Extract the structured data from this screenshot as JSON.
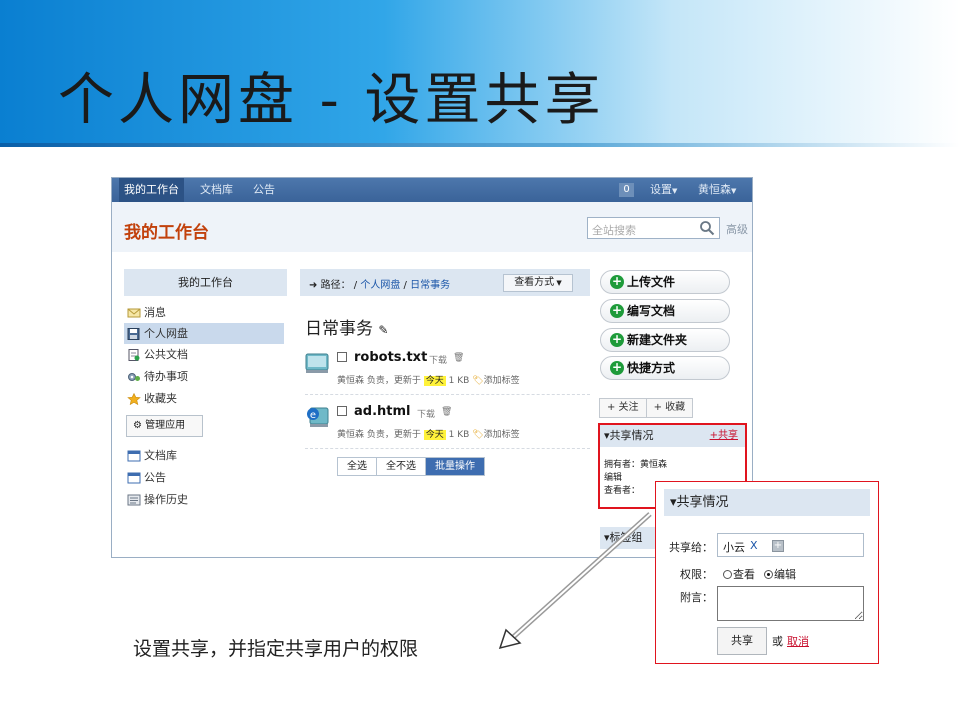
{
  "slide": {
    "title": "个人网盘  -  设置共享",
    "caption": "设置共享，并指定共享用户的权限"
  },
  "colors": {
    "nav_bg": "#3a6399",
    "panel_bg": "#dce6f1",
    "title_orange": "#c2410c",
    "highlight_red": "#e0141e",
    "primary_btn": "#3e6db0",
    "plus_green": "#1e9b3a",
    "today_yellow": "#fff23a"
  },
  "topnav": {
    "items": [
      "我的工作台",
      "文档库",
      "公告"
    ],
    "badge": "0",
    "settings": "设置",
    "user": "黄恒森"
  },
  "header": {
    "title": "我的工作台",
    "search_placeholder": "全站搜索",
    "advanced": "高级"
  },
  "sidebar": {
    "heading": "我的工作台",
    "items": [
      {
        "label": "消息",
        "icon": "envelope-icon"
      },
      {
        "label": "个人网盘",
        "icon": "disk-icon"
      },
      {
        "label": "公共文档",
        "icon": "document-icon"
      },
      {
        "label": "待办事项",
        "icon": "gear-people-icon"
      },
      {
        "label": "收藏夹",
        "icon": "star-icon"
      }
    ],
    "manage_button": "管理应用",
    "items2": [
      {
        "label": "文档库",
        "icon": "window-icon"
      },
      {
        "label": "公告",
        "icon": "window-icon"
      },
      {
        "label": "操作历史",
        "icon": "history-icon"
      }
    ]
  },
  "main": {
    "path_label": "路径：",
    "path_sep": "/",
    "path_items": [
      "个人网盘",
      "日常事务"
    ],
    "view_button": "查看方式",
    "folder_title": "日常事务",
    "files": [
      {
        "name": "robots.txt",
        "download": "下载",
        "owner": "黄恒森 负责，更新于",
        "today": "今天",
        "size": "1 KB",
        "tag": "添加标签"
      },
      {
        "name": "ad.html",
        "download": "下载",
        "owner": "黄恒森 负责，更新于",
        "today": "今天",
        "size": "1 KB",
        "tag": "添加标签"
      }
    ],
    "select_all": "全选",
    "select_none": "全不选",
    "batch": "批量操作"
  },
  "right": {
    "actions": [
      "上传文件",
      "编写文档",
      "新建文件夹",
      "快捷方式"
    ],
    "follow": "+ 关注",
    "favorite": "+ 收藏",
    "share_heading": "▾共享情况",
    "share_add": "+共享",
    "owner_line": "拥有者：黄恒森",
    "edit_line": "编辑",
    "viewer_line": "查看者：",
    "tag_group": "▾标签组"
  },
  "popup": {
    "heading": "▾共享情况",
    "share_to_label": "共享给：",
    "share_to_user": "小云",
    "remove": "X",
    "permission_label": "权限：",
    "permission_view": "查看",
    "permission_edit": "编辑",
    "permission_selected": "编辑",
    "message_label": "附言：",
    "submit": "共享",
    "or": "或",
    "cancel": "取消"
  }
}
